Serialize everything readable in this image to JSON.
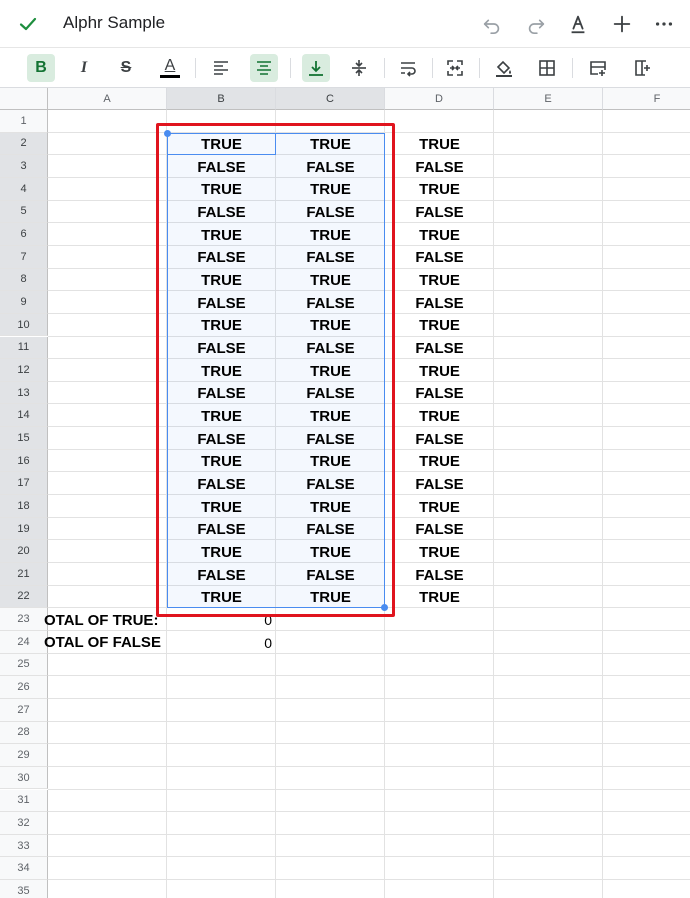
{
  "header": {
    "title": "Alphr Sample",
    "icons": [
      "check-icon",
      "undo-icon",
      "redo-icon",
      "text-format-icon",
      "add-icon",
      "more-icon"
    ]
  },
  "toolbar": {
    "bold": "B",
    "italic": "I",
    "strikethrough": "S",
    "text_color": "A",
    "icons": [
      "bold-icon",
      "italic-icon",
      "strikethrough-icon",
      "text-color-icon",
      "align-left-icon",
      "align-center-icon",
      "valign-bottom-icon",
      "valign-middle-icon",
      "wrap-text-icon",
      "merge-cells-icon",
      "fill-color-icon",
      "borders-icon",
      "insert-row-icon",
      "insert-column-icon"
    ]
  },
  "sheet": {
    "columns": [
      "A",
      "B",
      "C",
      "D",
      "E",
      "F"
    ],
    "rows": [
      "1",
      "2",
      "3",
      "4",
      "5",
      "6",
      "7",
      "8",
      "9",
      "10",
      "11",
      "12",
      "13",
      "14",
      "15",
      "16",
      "17",
      "18",
      "19",
      "20",
      "21",
      "22",
      "23",
      "24",
      "25",
      "26",
      "27",
      "28",
      "29",
      "30",
      "31",
      "32",
      "33",
      "34",
      "35"
    ],
    "bool_rows": [
      [
        "TRUE",
        "TRUE",
        "TRUE"
      ],
      [
        "FALSE",
        "FALSE",
        "FALSE"
      ],
      [
        "TRUE",
        "TRUE",
        "TRUE"
      ],
      [
        "FALSE",
        "FALSE",
        "FALSE"
      ],
      [
        "TRUE",
        "TRUE",
        "TRUE"
      ],
      [
        "FALSE",
        "FALSE",
        "FALSE"
      ],
      [
        "TRUE",
        "TRUE",
        "TRUE"
      ],
      [
        "FALSE",
        "FALSE",
        "FALSE"
      ],
      [
        "TRUE",
        "TRUE",
        "TRUE"
      ],
      [
        "FALSE",
        "FALSE",
        "FALSE"
      ],
      [
        "TRUE",
        "TRUE",
        "TRUE"
      ],
      [
        "FALSE",
        "FALSE",
        "FALSE"
      ],
      [
        "TRUE",
        "TRUE",
        "TRUE"
      ],
      [
        "FALSE",
        "FALSE",
        "FALSE"
      ],
      [
        "TRUE",
        "TRUE",
        "TRUE"
      ],
      [
        "FALSE",
        "FALSE",
        "FALSE"
      ],
      [
        "TRUE",
        "TRUE",
        "TRUE"
      ],
      [
        "FALSE",
        "FALSE",
        "FALSE"
      ],
      [
        "TRUE",
        "TRUE",
        "TRUE"
      ],
      [
        "FALSE",
        "FALSE",
        "FALSE"
      ],
      [
        "TRUE",
        "TRUE",
        "TRUE"
      ]
    ],
    "total_true_label": "OTAL OF TRUE:",
    "total_true_value": "0",
    "total_false_label": "OTAL OF FALSE",
    "total_false_value": "0",
    "selection": "B2:C22",
    "highlight_color": "#e0141e",
    "accent_color": "#1e8e3e",
    "selection_color": "#4a8cf0"
  }
}
